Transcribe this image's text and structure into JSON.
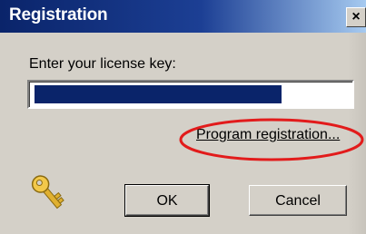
{
  "window": {
    "title": "Registration",
    "close_glyph": "×"
  },
  "form": {
    "prompt_label": "Enter your license key:",
    "license_key_value": "",
    "license_key_state": "text selected (highlighted)"
  },
  "links": {
    "program_registration": "Program registration..."
  },
  "buttons": {
    "ok_label": "OK",
    "cancel_label": "Cancel"
  },
  "icons": {
    "key": "key-icon"
  },
  "colors": {
    "title_bar": "#0a246a",
    "selection": "#0a246a",
    "dialog_bg": "#d4d0c8",
    "annotation_circle": "#e21b1b"
  }
}
